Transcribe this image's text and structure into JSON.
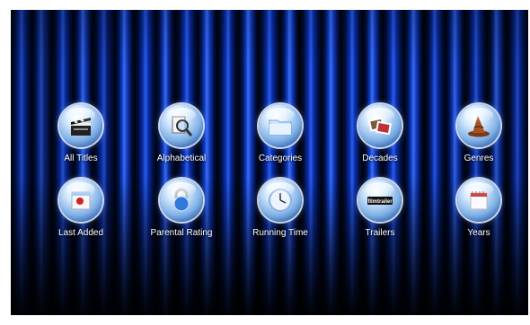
{
  "menu": {
    "items": [
      {
        "label": "All Titles",
        "icon": "clapperboard-icon"
      },
      {
        "label": "Alphabetical",
        "icon": "magnifier-icon"
      },
      {
        "label": "Categories",
        "icon": "folder-icon"
      },
      {
        "label": "Decades",
        "icon": "photos-icon"
      },
      {
        "label": "Genres",
        "icon": "wizard-hat-icon"
      },
      {
        "label": "Last Added",
        "icon": "calendar-new-icon"
      },
      {
        "label": "Parental Rating",
        "icon": "padlock-icon"
      },
      {
        "label": "Running Time",
        "icon": "clock-icon"
      },
      {
        "label": "Trailers",
        "icon": "filmtrailer-icon"
      },
      {
        "label": "Years",
        "icon": "calendar-icon"
      }
    ],
    "trailers_logo_text": "filmtrailer"
  },
  "colors": {
    "curtain": "#1a48d8",
    "background": "#000614",
    "label": "#ffffff"
  }
}
